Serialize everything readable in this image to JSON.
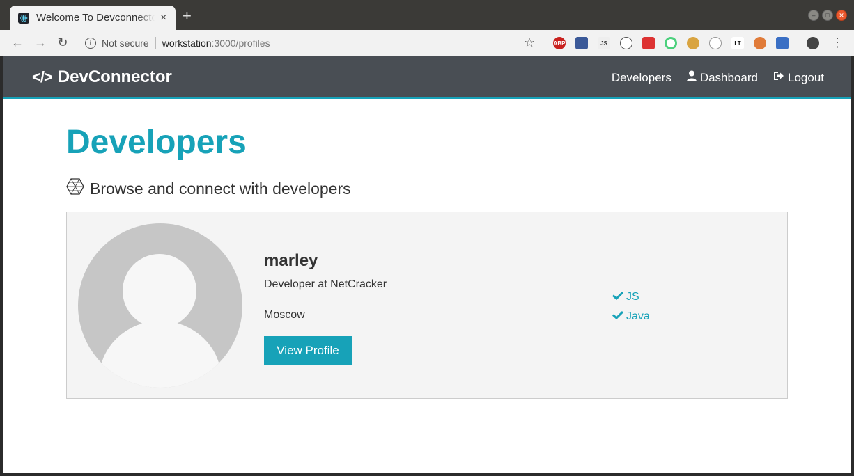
{
  "browser": {
    "tab_title": "Welcome To Devconnector",
    "new_tab": "+",
    "close_tab": "×",
    "security_label": "Not secure",
    "url_host": "workstation",
    "url_path": ":3000/profiles",
    "ext_abp": "ABP",
    "ext_js": "JS",
    "ext_lt": "LT"
  },
  "navbar": {
    "brand": "DevConnector",
    "links": [
      {
        "label": "Developers"
      },
      {
        "label": "Dashboard"
      },
      {
        "label": "Logout"
      }
    ]
  },
  "main": {
    "heading": "Developers",
    "lead": "Browse and connect with developers"
  },
  "profile": {
    "name": "marley",
    "status": "Developer at NetCracker",
    "location": "Moscow",
    "button": "View Profile",
    "skills": [
      "JS",
      "Java"
    ]
  },
  "colors": {
    "accent": "#17a2b8",
    "navbar": "#494e54"
  }
}
